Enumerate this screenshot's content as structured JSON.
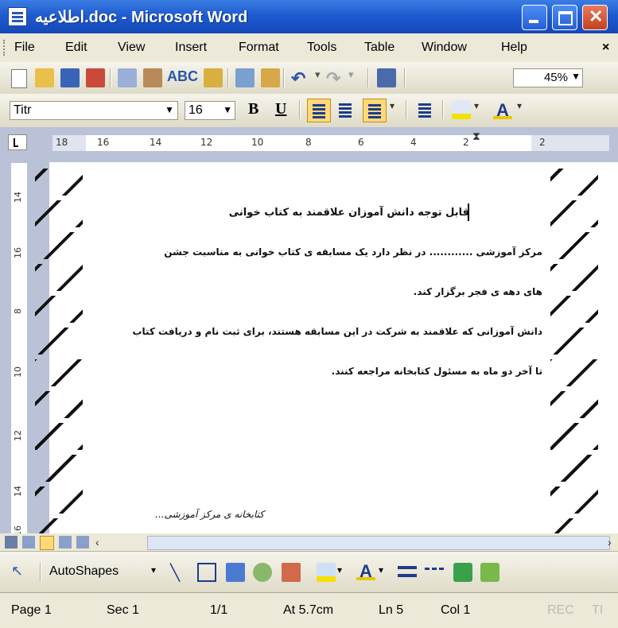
{
  "window": {
    "title": ".doc - Microsoft Word",
    "doc_name": "اطلاعیه"
  },
  "menu": [
    "File",
    "Edit",
    "View",
    "Insert",
    "Format",
    "Tools",
    "Table",
    "Window",
    "Help"
  ],
  "standard_toolbar": {
    "zoom": "45%"
  },
  "formatting_toolbar": {
    "font": "Titr",
    "size": "16",
    "bold": "B",
    "underline": "U"
  },
  "ruler": {
    "h_ticks": [
      "18",
      "16",
      "14",
      "12",
      "10",
      "8",
      "6",
      "4",
      "2",
      "2"
    ],
    "v_ticks": [
      "14",
      "16",
      "8",
      "10",
      "12",
      "14",
      "16"
    ]
  },
  "document": {
    "heading": "قابل توجه دانش آموزان علاقمند به کتاب خوانی",
    "line1": "مرکز آموزشی ............ در نظر دارد یک مسابقه ی کتاب خوانی به مناسبت جشن",
    "line2": "های دهه ی فجر برگزار کند.",
    "line3": "دانش آموزانی که علاقمند به شرکت در این مسابقه هستند، برای ثبت نام و دریافت کتاب",
    "line4": "تا آخر دو ماه به مسئول کتابخانه مراجعه کنند.",
    "signature": "کتابخانه ی مرکز آموزشی..."
  },
  "drawing_toolbar": {
    "autoshapes": "AutoShapes"
  },
  "status": {
    "page": "Page 1",
    "sec": "Sec 1",
    "pages": "1/1",
    "at": "At 5.7cm",
    "ln": "Ln 5",
    "col": "Col 1",
    "rec": "REC",
    "trk": "TI"
  }
}
